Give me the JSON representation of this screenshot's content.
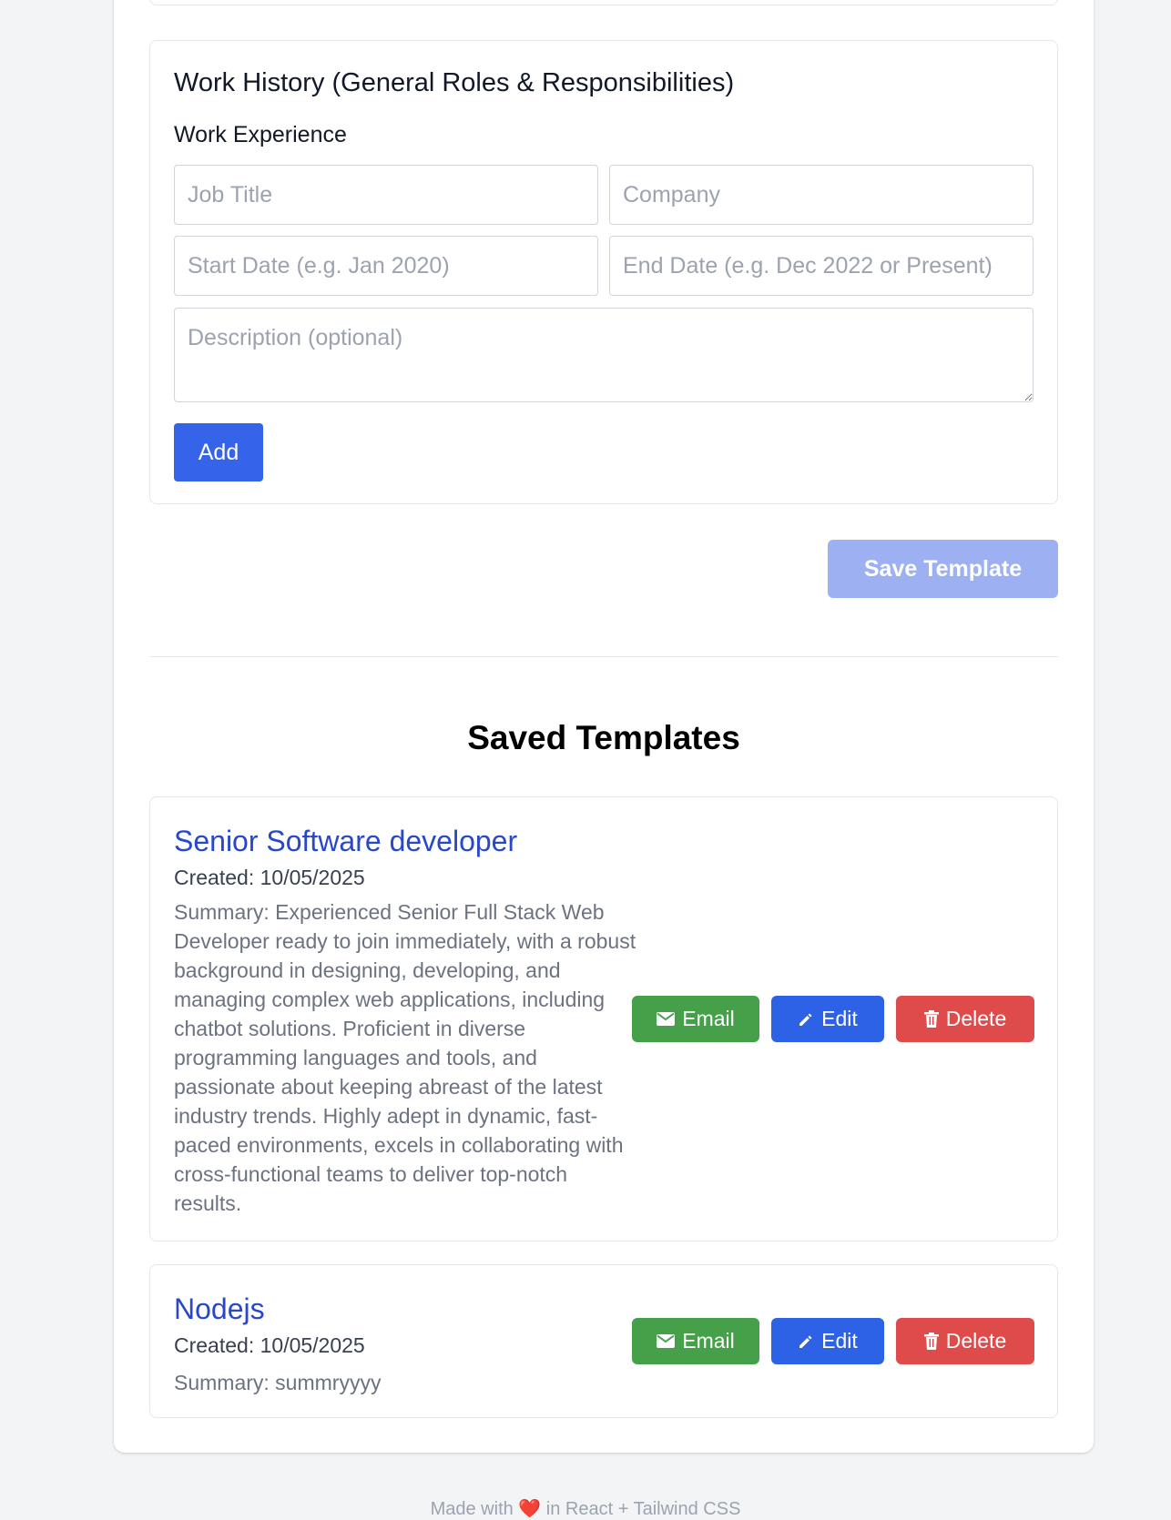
{
  "work_history": {
    "title": "Work History (General Roles & Responsibilities)",
    "subtitle": "Work Experience",
    "job_title_placeholder": "Job Title",
    "company_placeholder": "Company",
    "start_date_placeholder": "Start Date (e.g. Jan 2020)",
    "end_date_placeholder": "End Date (e.g. Dec 2022 or Present)",
    "description_placeholder": "Description (optional)",
    "add_label": "Add"
  },
  "save_template_label": "Save Template",
  "saved": {
    "heading": "Saved Templates",
    "templates": [
      {
        "title": "Senior Software developer",
        "created": "Created: 10/05/2025",
        "summary": "Summary: Experienced Senior Full Stack Web Developer ready to join immediately, with a robust background in designing, developing, and managing complex web applications, including chatbot solutions. Proficient in diverse programming languages and tools, and passionate about keeping abreast of the latest industry trends. Highly adept in dynamic, fast-paced environments, excels in collaborating with cross-functional teams to deliver top-notch results."
      },
      {
        "title": "Nodejs",
        "created": "Created: 10/05/2025",
        "summary": "Summary: summryyyy"
      }
    ],
    "email_label": "Email",
    "edit_label": "Edit",
    "delete_label": "Delete"
  },
  "footer": {
    "prefix": "Made with",
    "heart": "❤️",
    "suffix": "in React + Tailwind CSS"
  },
  "colors": {
    "primary": "#3563e9",
    "save_disabled": "#9db1f2",
    "title_link": "#2848c9",
    "email": "#45a049",
    "edit": "#2e62e6",
    "delete": "#df4b4b"
  },
  "icons": {
    "email": "envelope-icon",
    "edit": "pencil-icon",
    "delete": "trash-icon"
  }
}
